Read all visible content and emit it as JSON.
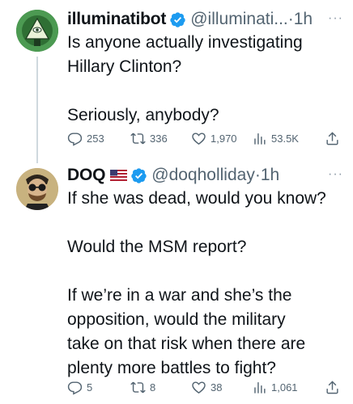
{
  "tweets": [
    {
      "name": "illuminatibot",
      "handle": "@illuminati...",
      "separator": "·",
      "time": "1h",
      "more": "···",
      "text": "Is anyone actually investigating\nHillary Clinton?\n\nSeriously, anybody?",
      "replies": "253",
      "retweets": "336",
      "likes": "1,970",
      "views": "53.5K"
    },
    {
      "name": "DOQ",
      "handle": "@doqholliday",
      "separator": "·",
      "time": "1h",
      "more": "···",
      "text": "If she was dead, would you know?\n\nWould the MSM report?\n\nIf we’re in a war and she’s the\nopposition, would the military\ntake on that risk when there are\nplenty more battles to fight?",
      "replies": "5",
      "retweets": "8",
      "likes": "38",
      "views": "1,061"
    }
  ],
  "icons": {
    "verified": "verified-badge-icon",
    "reply": "reply-icon",
    "retweet": "retweet-icon",
    "like": "heart-icon",
    "views": "views-icon",
    "share": "share-icon",
    "flag": "us-flag-icon"
  },
  "colors": {
    "verified": "#1d9bf0",
    "text": "#0f1419",
    "secondary": "#536471",
    "thread_line": "#cfd9de"
  }
}
